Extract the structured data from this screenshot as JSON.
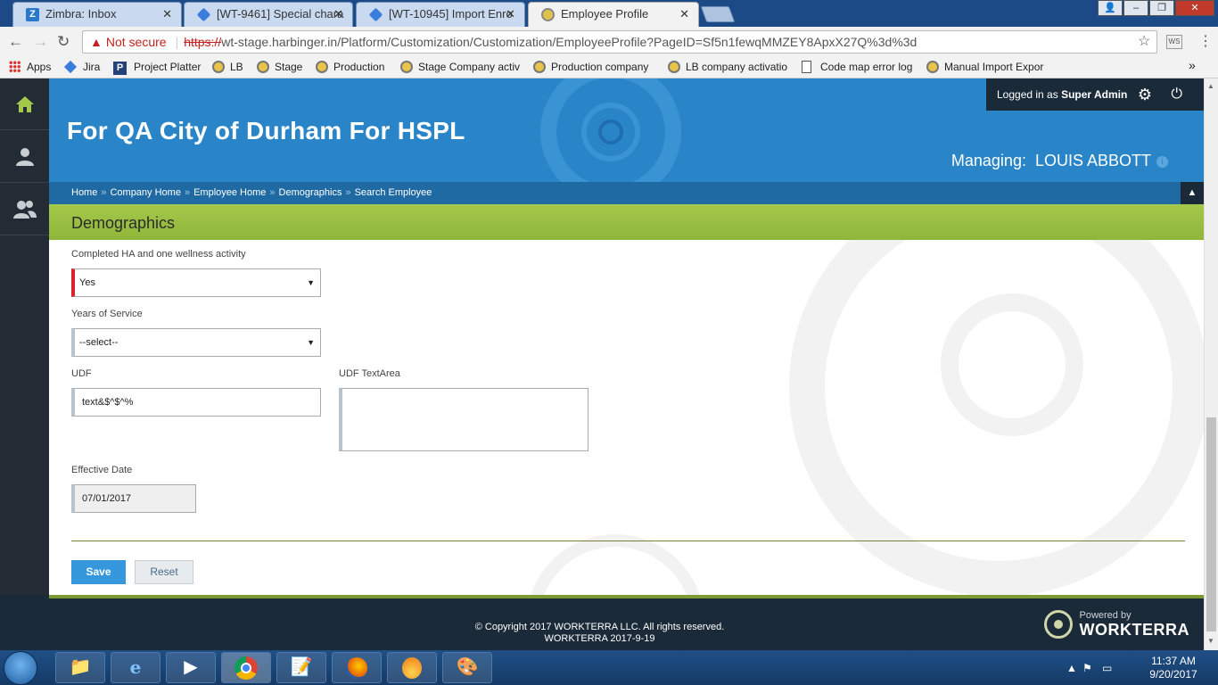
{
  "browser": {
    "tabs": [
      {
        "title": "Zimbra: Inbox",
        "icon": "zimbra-icon",
        "active": false
      },
      {
        "title": "[WT-9461] Special chara",
        "icon": "jira-icon",
        "active": false
      },
      {
        "title": "[WT-10945] Import Enro",
        "icon": "jira-icon",
        "active": false
      },
      {
        "title": "Employee Profile",
        "icon": "workterra-favicon",
        "active": true
      }
    ],
    "security_label": "Not secure",
    "url_scheme": "https://",
    "url_rest": "wt-stage.harbinger.in/Platform/Customization/Customization/EmployeeProfile?PageID=Sf5n1fewqMMZEY8ApxX27Q%3d%3d",
    "bookmarks": [
      "Apps",
      "Jira",
      "Project Platter",
      "LB",
      "Stage",
      "Production",
      "Stage Company activ",
      "Production company",
      "LB company activatio",
      "Code map error log",
      "Manual Import Expor"
    ],
    "overflow_label": "»"
  },
  "header": {
    "company_name": "For QA City of Durham For HSPL",
    "logged_in_prefix": "Logged in as",
    "logged_in_user": "Super Admin",
    "managing_label": "Managing:",
    "managing_name": "LOUIS ABBOTT"
  },
  "breadcrumb": [
    "Home",
    "Company Home",
    "Employee Home",
    "Demographics",
    "Search Employee"
  ],
  "breadcrumb_separator": "»",
  "section_title": "Demographics",
  "form": {
    "completed_ha_label": "Completed HA and one wellness activity",
    "completed_ha_value": "Yes",
    "years_of_service_label": "Years of Service",
    "years_of_service_value": "--select--",
    "udf_label": "UDF",
    "udf_value": "text&$^$^%",
    "udf_textarea_label": "UDF TextArea",
    "udf_textarea_value": "",
    "effective_date_label": "Effective Date",
    "effective_date_value": "07/01/2017",
    "save_label": "Save",
    "reset_label": "Reset"
  },
  "footer": {
    "copyright": "© Copyright 2017 WORKTERRA LLC. All rights reserved.",
    "version": "WORKTERRA 2017-9-19",
    "powered_by": "Powered by",
    "brand": "WORKTERRA"
  },
  "taskbar": {
    "time": "11:37 AM",
    "date": "9/20/2017"
  },
  "colors": {
    "banner_blue": "#2a85c8",
    "section_green": "#8fb63a",
    "required_red": "#d9232d",
    "save_blue": "#3598dc",
    "dark_navy": "#1b2a38"
  }
}
